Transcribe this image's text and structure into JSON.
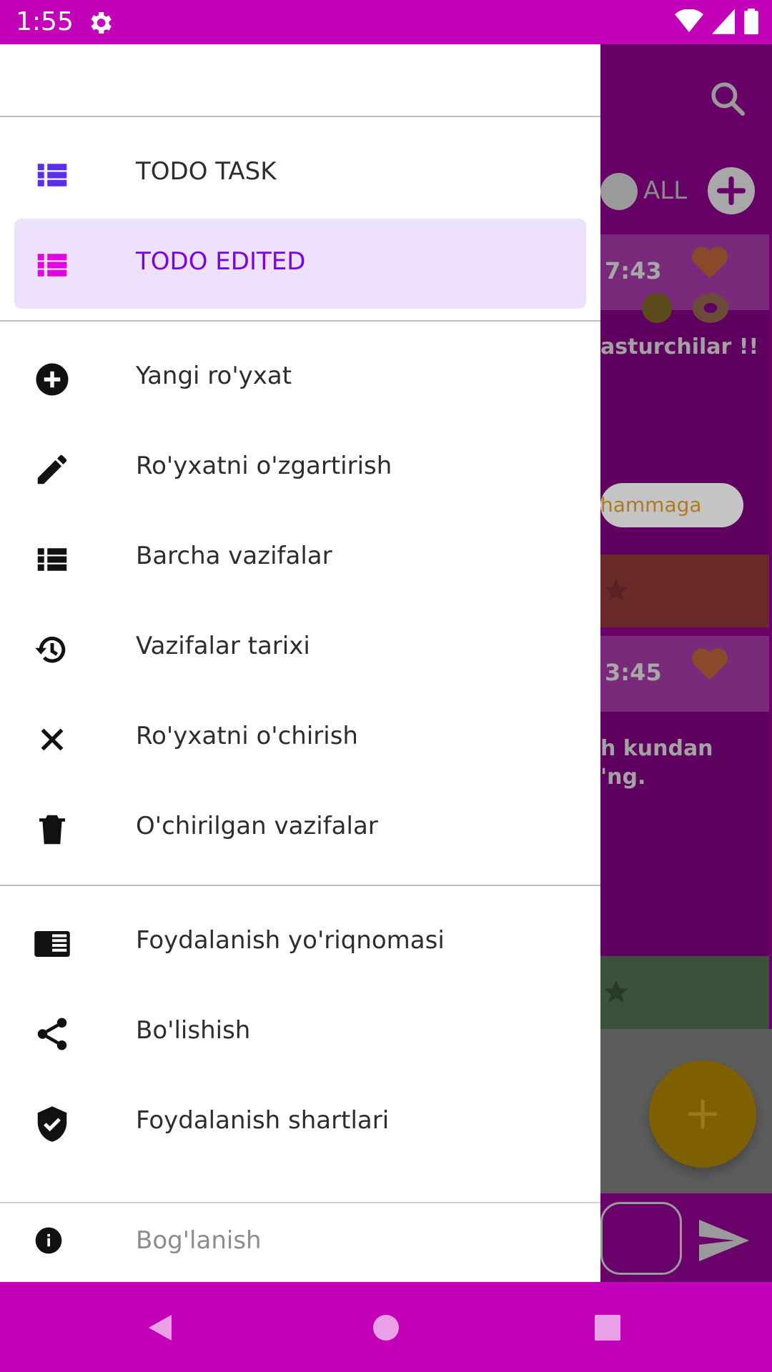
{
  "status_bar": {
    "time": "1:55"
  },
  "background_app": {
    "all_label": "ALL",
    "card1_time": "7:43",
    "card1_text": "asturchilar !!",
    "chip_text": "hammaga",
    "card2_time": "3:45",
    "card2_text_line1": "h kundan",
    "card2_text_line2": "'ng."
  },
  "drawer": {
    "lists": [
      {
        "label": "TODO TASK",
        "icon": "list-icon"
      },
      {
        "label": "TODO EDITED",
        "icon": "list-icon",
        "selected": true
      }
    ],
    "actions": [
      {
        "label": "Yangi ro'yxat",
        "icon": "add-circle-icon"
      },
      {
        "label": "Ro'yxatni o'zgartirish",
        "icon": "pencil-icon"
      },
      {
        "label": "Barcha vazifalar",
        "icon": "list-icon"
      },
      {
        "label": "Vazifalar tarixi",
        "icon": "history-icon"
      },
      {
        "label": "Ro'yxatni o'chirish",
        "icon": "close-icon"
      },
      {
        "label": "O'chirilgan vazifalar",
        "icon": "trash-icon"
      }
    ],
    "info": [
      {
        "label": "Foydalanish yo'riqnomasi",
        "icon": "manual-icon"
      },
      {
        "label": "Bo'lishish",
        "icon": "share-icon"
      },
      {
        "label": "Foydalanish shartlari",
        "icon": "shield-check-icon"
      }
    ],
    "footer": {
      "label": "Bog'lanish",
      "icon": "info-icon"
    }
  },
  "colors": {
    "status_bar": "#c200b8",
    "selected_text": "#7a00e6",
    "selected_bg": "#ede1fb",
    "list_icon_blue": "#5a2df0",
    "list_icon_pink": "#e000e0"
  }
}
